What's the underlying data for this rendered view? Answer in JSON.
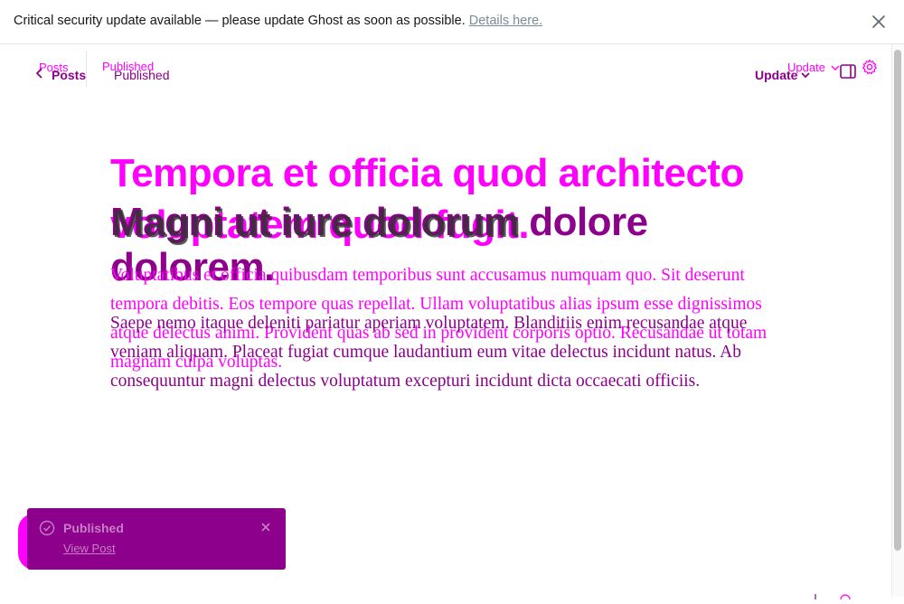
{
  "banner": {
    "message": "Critical security update available — please update Ghost as soon as possible.",
    "link_label": "Details here."
  },
  "header": {
    "back_label": "Posts",
    "status_label": "Published",
    "update_label": "Update"
  },
  "post": {
    "title": "Tempora et officia quod architecto voluptatem quod fugit.",
    "title_overlay": "Magni ut iure dolorum dolore dolorem.",
    "title_dark_fragment": "Magni ut iure dolorum",
    "body": "Voluptatibus et officia quibusdam temporibus sunt accusamus numquam quo. Sit deserunt tempora debitis. Eos tempore quas repellat. Ullam voluptatibus alias ipsum esse dignissimos atque delectus animi. Provident quas ab sed in provident corporis optio. Recusandae ut totam magnam culpa voluptas.",
    "body_overlay": "Saepe nemo itaque deleniti pariatur aperiam voluptatem. Blanditiis enim recusandae atque veniam aliquam. Placeat fugiat cumque laudantium eum vitae delectus incidunt natus. Ab consequuntur magni delectus voluptatum excepturi incidunt dicta occaecati officiis."
  },
  "toast": {
    "title": "Published",
    "link_label": "View Post"
  },
  "colors": {
    "accent_ghost": "#ff00ff",
    "accent_main": "#8c008c"
  }
}
